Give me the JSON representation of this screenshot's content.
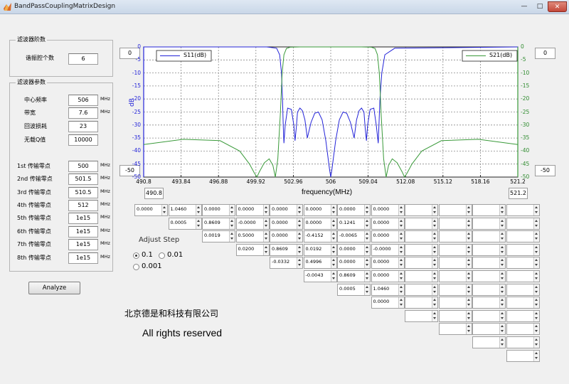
{
  "window": {
    "title": "BandPassCouplingMatrixDesign",
    "minimize": "—",
    "maximize": "□",
    "close": "✕"
  },
  "order_panel": {
    "title": "滤波器阶数",
    "label": "谐振腔个数",
    "value": "6"
  },
  "params_panel": {
    "title": "滤波器参数",
    "rows": [
      {
        "label": "中心频率",
        "value": "506",
        "unit": "MHz"
      },
      {
        "label": "带宽",
        "value": "7.6",
        "unit": "MHz"
      },
      {
        "label": "回波损耗",
        "value": "23",
        "unit": ""
      },
      {
        "label": "无载Q值",
        "value": "10000",
        "unit": ""
      }
    ],
    "zeros": [
      {
        "label": "1st 传输零点",
        "value": "500",
        "unit": "MHz"
      },
      {
        "label": "2nd 传输零点",
        "value": "501.5",
        "unit": "MHz"
      },
      {
        "label": "3rd 传输零点",
        "value": "510.5",
        "unit": "MHz"
      },
      {
        "label": "4th 传输零点",
        "value": "512",
        "unit": "MHz"
      },
      {
        "label": "5th 传输零点",
        "value": "1e15",
        "unit": "MHz"
      },
      {
        "label": "6th 传输零点",
        "value": "1e15",
        "unit": "MHz"
      },
      {
        "label": "7th 传输零点",
        "value": "1e15",
        "unit": "MHz"
      },
      {
        "label": "8th 传输零点",
        "value": "1e15",
        "unit": "MHz"
      }
    ]
  },
  "analyze_button": "Analyze",
  "company": "北京德是和科技有限公司",
  "rights": "All rights reserved",
  "adjust_step": {
    "label": "Adjust Step",
    "options": [
      "0.1",
      "0.01",
      "0.001"
    ],
    "selected": "0.1"
  },
  "axis_inputs": {
    "y_left_max": "0",
    "y_left_min": "-50",
    "y_right_max": "0",
    "y_right_min": "-50",
    "x_min": "490.8",
    "x_max": "521.2"
  },
  "matrix": {
    "size": 12,
    "rows": [
      [
        "0.0000",
        "1.0460",
        "0.0000",
        "0.0000",
        "0.0000",
        "0.0000",
        "0.0000",
        "0.0000",
        "",
        "",
        "",
        ""
      ],
      [
        "0.0005",
        "0.8609",
        "-0.0000",
        "0.0000",
        "0.0000",
        "0.1241",
        "0.0000",
        "",
        "",
        "",
        ""
      ],
      [
        "0.0019",
        "0.5000",
        "0.0000",
        "-0.4152",
        "-0.0065",
        "0.0000",
        "",
        "",
        "",
        ""
      ],
      [
        "0.0200",
        "0.8609",
        "0.0192",
        "0.0000",
        "-0.0000",
        "",
        "",
        "",
        ""
      ],
      [
        "-0.0332",
        "0.4996",
        "0.0000",
        "0.0000",
        "",
        "",
        "",
        ""
      ],
      [
        "-0.0043",
        "0.8609",
        "0.0000",
        "",
        "",
        "",
        ""
      ],
      [
        "0.0005",
        "1.0460",
        "",
        "",
        "",
        ""
      ],
      [
        "0.0000",
        "",
        "",
        "",
        ""
      ],
      [
        "",
        "",
        "",
        ""
      ],
      [
        "",
        "",
        ""
      ],
      [
        "",
        ""
      ],
      [
        ""
      ]
    ]
  },
  "chart_data": {
    "type": "line",
    "xlabel": "frequency(MHz)",
    "ylabel": "dB",
    "xlim": [
      490.8,
      521.2
    ],
    "ylim": [
      -50,
      0
    ],
    "xticks": [
      "490.8",
      "493.84",
      "496.88",
      "499.92",
      "502.96",
      "506",
      "509.04",
      "512.08",
      "515.12",
      "518.16",
      "521.2"
    ],
    "yticks_left": [
      "0",
      "-5",
      "-10",
      "-15",
      "-20",
      "-25",
      "-30",
      "-35",
      "-40",
      "-45",
      "-50"
    ],
    "yticks_right": [
      "0",
      "-5",
      "-10",
      "-15",
      "-20",
      "-25",
      "-30",
      "-35",
      "-40",
      "-45",
      "-50"
    ],
    "grid": true,
    "legend_left": "S11(dB)",
    "legend_right": "S21(dB)",
    "series": [
      {
        "name": "S11(dB)",
        "color": "#2323d8",
        "x": [
          490.8,
          500.8,
          501.6,
          501.85,
          502.0,
          502.08,
          502.14,
          502.2,
          502.3,
          502.5,
          502.8,
          503.0,
          503.1,
          503.2,
          503.3,
          503.5,
          503.7,
          503.9,
          504.1,
          504.4,
          504.7,
          505.0,
          505.3,
          505.6,
          505.9,
          506.0,
          506.1,
          506.4,
          506.7,
          507.0,
          507.3,
          507.6,
          507.9,
          508.1,
          508.3,
          508.5,
          508.7,
          508.8,
          508.9,
          509.0,
          509.2,
          509.5,
          509.7,
          509.86,
          509.92,
          510.0,
          510.15,
          510.4,
          511.2,
          521.2
        ],
        "y": [
          0,
          0,
          -0.5,
          -3,
          -10,
          -20,
          -30,
          -37,
          -30,
          -23.5,
          -24,
          -30,
          -36,
          -31,
          -25,
          -23.5,
          -24.5,
          -28,
          -35,
          -29,
          -25.5,
          -25,
          -28,
          -36,
          -47,
          -50,
          -47,
          -36,
          -28,
          -25,
          -25.5,
          -29,
          -35,
          -28,
          -24.5,
          -23.5,
          -25,
          -31,
          -36,
          -30,
          -24,
          -23.5,
          -30,
          -37,
          -30,
          -20,
          -10,
          -3,
          -0.5,
          0
        ]
      },
      {
        "name": "S21(dB)",
        "color": "#3a9a3a",
        "x": [
          490.8,
          494,
          497,
          498.6,
          499.4,
          499.8,
          500.0,
          500.2,
          500.6,
          501.0,
          501.3,
          501.5,
          501.7,
          501.9,
          502.05,
          502.2,
          502.4,
          502.7,
          503.5,
          506,
          508.5,
          509.3,
          509.6,
          509.8,
          509.95,
          510.1,
          510.3,
          510.5,
          510.7,
          511.0,
          511.4,
          511.8,
          512.0,
          512.2,
          512.6,
          513.4,
          515,
          518,
          521.2
        ],
        "y": [
          -37.5,
          -35.5,
          -36,
          -40,
          -45,
          -48.5,
          -50,
          -48,
          -44.5,
          -43,
          -45.5,
          -50,
          -43,
          -26,
          -10,
          -3,
          -0.6,
          -0.1,
          0,
          0,
          0,
          -0.1,
          -0.6,
          -3,
          -10,
          -26,
          -43,
          -50,
          -45.5,
          -43,
          -44.5,
          -48,
          -50,
          -48.5,
          -45,
          -40,
          -36,
          -35.5,
          -37.5
        ]
      }
    ]
  }
}
